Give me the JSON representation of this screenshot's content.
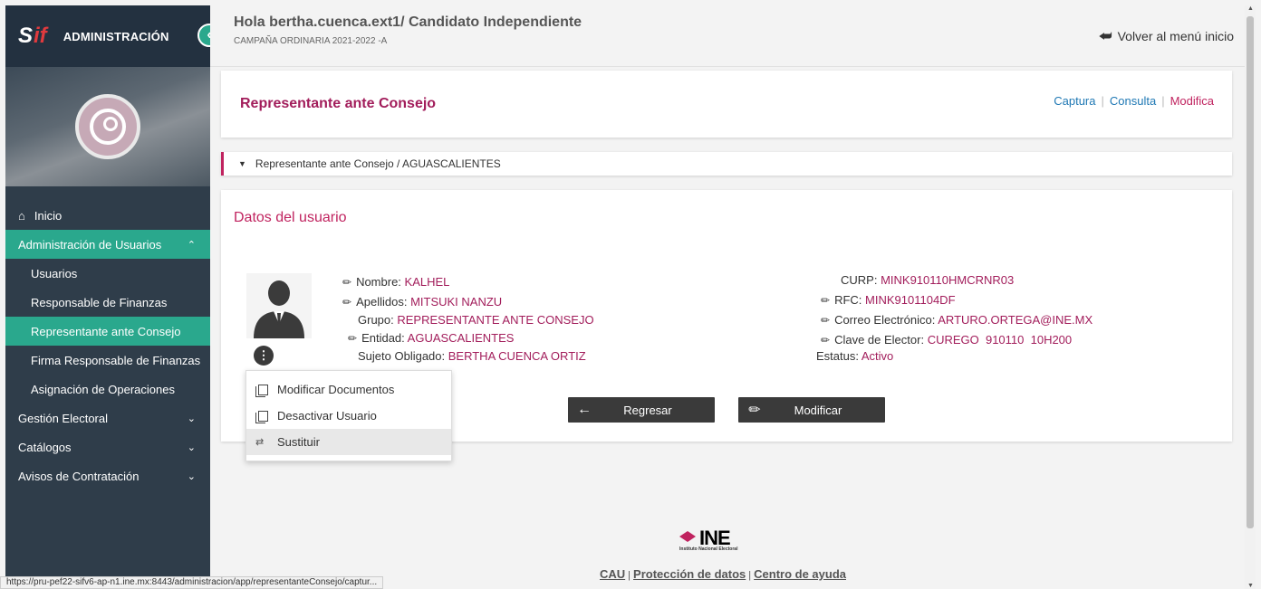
{
  "sidebar": {
    "logo_s": "S",
    "logo_if": "if",
    "title": "ADMINISTRACIÓN",
    "collapse_glyph": "‹",
    "items": [
      {
        "label": "Inicio",
        "icon": "home-icon"
      },
      {
        "label": "Administración de Usuarios",
        "expanded": true
      },
      {
        "label": "Usuarios"
      },
      {
        "label": "Responsable de Finanzas"
      },
      {
        "label": "Representante ante Consejo",
        "active": true
      },
      {
        "label": "Firma Responsable de Finanzas"
      },
      {
        "label": "Asignación de Operaciones"
      },
      {
        "label": "Gestión Electoral"
      },
      {
        "label": "Catálogos"
      },
      {
        "label": "Avisos de Contratación"
      }
    ]
  },
  "header": {
    "greeting": "Hola bertha.cuenca.ext1/ Candidato Independiente",
    "campaign": "CAMPAÑA ORDINARIA 2021-2022 -A",
    "back_menu": "Volver al menú inicio"
  },
  "page": {
    "title": "Representante ante Consejo",
    "tabs": [
      "Captura",
      "Consulta",
      "Modifica"
    ],
    "current_tab": "Modifica",
    "breadcrumb": "Representante ante Consejo / AGUASCALIENTES"
  },
  "user": {
    "section_title": "Datos del usuario",
    "nombre_label": "Nombre:",
    "nombre": "KALHEL",
    "apellidos_label": "Apellidos:",
    "apellidos": "MITSUKI NANZU",
    "grupo_label": "Grupo:",
    "grupo": "REPRESENTANTE ANTE CONSEJO",
    "entidad_label": "Entidad:",
    "entidad": "AGUASCALIENTES",
    "sujeto_label": "Sujeto Obligado:",
    "sujeto": "BERTHA CUENCA ORTIZ",
    "curp_label": "CURP:",
    "curp": "MINK910110HMCRNR03",
    "rfc_label": "RFC:",
    "rfc": "MINK9101104DF",
    "correo_label": "Correo Electrónico:",
    "correo": "ARTURO.ORTEGA@INE.MX",
    "clave_label": "Clave de Elector:",
    "clave": "CUREGO  910110  10H200",
    "estatus_label": "Estatus:",
    "estatus": "Activo"
  },
  "buttons": {
    "regresar": "Regresar",
    "modificar": "Modificar"
  },
  "menu": {
    "items": [
      "Modificar Documentos",
      "Desactivar Usuario",
      "Sustituir"
    ]
  },
  "footer": {
    "ine": "INE",
    "ine_sub": "Instituto Nacional Electoral",
    "links": [
      "CAU",
      "Protección de datos",
      "Centro de ayuda"
    ]
  },
  "statusbar": "https://pru-pef22-sifv6-ap-n1.ine.mx:8443/administracion/app/representanteConsejo/captur...",
  "colors": {
    "accent": "#c0235f",
    "sidebar": "#2f3d4a",
    "active": "#2aa88d"
  }
}
